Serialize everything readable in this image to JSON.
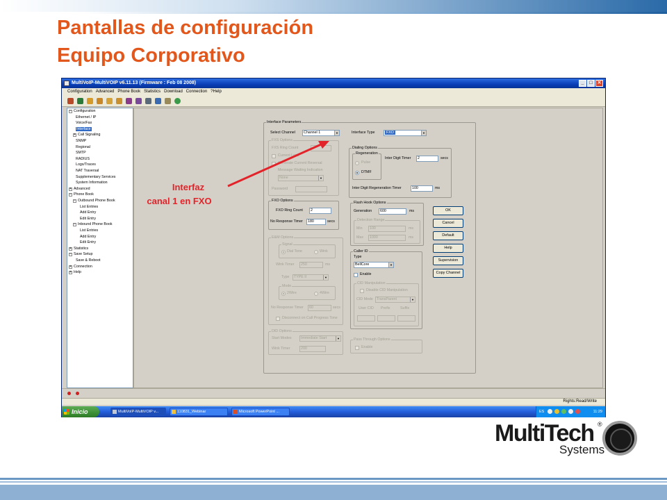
{
  "slide": {
    "title_line1": "Pantallas de configuración",
    "title_line2": "Equipo Corporativo",
    "annotation_line1": "Interfaz",
    "annotation_line2": "canal 1 en FXO"
  },
  "logo": {
    "wordmark": "MultiTech",
    "subtitle": "Systems",
    "registered": "®"
  },
  "window": {
    "title": "MultiVoIP-MultiVOIP v6.11.13 (Firmware : Feb 08 2008)",
    "minimize": "_",
    "maximize": "□",
    "close": "✕"
  },
  "menu": [
    "Configuration",
    "Advanced",
    "Phone Book",
    "Statistics",
    "Download",
    "Connection",
    "?Help"
  ],
  "toolbar_icons": [
    "network-icon",
    "monitor-icon",
    "phone-icon",
    "phone-icon",
    "phone-icon",
    "phone-icon",
    "tools-icon",
    "tools-icon",
    "sync-icon",
    "chart-icon",
    "home-icon",
    "globe-icon"
  ],
  "tree": {
    "items": [
      {
        "label": "Configuration",
        "exp": "−"
      },
      {
        "label": "Ethernet / IP"
      },
      {
        "label": "Voice/Fax"
      },
      {
        "label": "Interface",
        "selected": true
      },
      {
        "label": "Call Signaling",
        "exp": "+"
      },
      {
        "label": "SNMP"
      },
      {
        "label": "Regional"
      },
      {
        "label": "SMTP"
      },
      {
        "label": "RADIUS"
      },
      {
        "label": "Logs/Traces"
      },
      {
        "label": "NAT Traversal"
      },
      {
        "label": "Supplementary Services"
      },
      {
        "label": "System Information"
      },
      {
        "label": "Advanced",
        "exp": "+"
      },
      {
        "label": "Phone Book",
        "exp": "−"
      },
      {
        "label": "Outbound Phone Book",
        "exp": "−"
      },
      {
        "label": "List Entries"
      },
      {
        "label": "Add Entry"
      },
      {
        "label": "Edit Entry"
      },
      {
        "label": "Inbound Phone Book",
        "exp": "−"
      },
      {
        "label": "List Entries"
      },
      {
        "label": "Add Entry"
      },
      {
        "label": "Edit Entry"
      },
      {
        "label": "Statistics",
        "exp": "+"
      },
      {
        "label": "Save Setup",
        "exp": "−"
      },
      {
        "label": "Save & Reboot"
      },
      {
        "label": "Connection",
        "exp": "+"
      },
      {
        "label": "Help",
        "exp": "+"
      }
    ]
  },
  "form": {
    "interface_parameters": "Interface Parameters",
    "select_channel_label": "Select Channel",
    "select_channel_value": "Channel 1",
    "interface_type_label": "Interface Type",
    "interface_type_value": "FXO",
    "fxs_options": {
      "title": "FXS Options",
      "ring_count": "FXS Ring Count",
      "current_loss": "Current Loss",
      "generate_reversal": "Generate Current Reversal",
      "message_waiting": "Message Waiting Indication",
      "none_value": "None",
      "password": "Password"
    },
    "dialing_options": {
      "title": "Dialing Options",
      "regeneration": "Regeneration",
      "pulse": "Pulse",
      "dtmf": "DTMF",
      "inter_digit_timer_label": "Inter Digit Timer",
      "inter_digit_timer_value": "2",
      "secs": "secs",
      "regen_timer_label": "Inter Digit Regeneration Timer",
      "regen_timer_value": "100",
      "ms": "ms"
    },
    "fxo_options": {
      "title": "FXO Options",
      "ring_count_label": "FXO Ring Count",
      "ring_count_value": "2",
      "no_response_label": "No Response Timer",
      "no_response_value": "180",
      "secs": "secs"
    },
    "flash_hook": {
      "title": "Flash Hook Options",
      "generation_label": "Generation",
      "generation_value": "600",
      "ms": "ms",
      "detection_range": "Detection Range",
      "min_label": "Min",
      "min_value": "100",
      "max_label": "Max",
      "max_value": "1000"
    },
    "em_options": {
      "title": "E&M Options",
      "signal": "Signal",
      "dial_tone": "Dial Tone",
      "wink": "Wink",
      "wink_timer_label": "Wink Timer",
      "wink_timer_value": "250",
      "ms": "ms",
      "type_label": "Type",
      "type_value": "TYPE II",
      "mode": "Mode",
      "two_wire": "2Wire",
      "four_wire": "4Wire",
      "no_response_label": "No Response Timer",
      "no_response_value": "60",
      "secs": "secs",
      "disconnect": "Disconnect on Call Progress Tone"
    },
    "did_options": {
      "title": "DID Options",
      "start_modes_label": "Start Modes",
      "start_modes_value": "Immediate Start",
      "wink_timer_label": "Wink Timer",
      "wink_timer_value": "200"
    },
    "caller_id": {
      "title": "Caller ID",
      "type_label": "Type",
      "type_value": "BellCore",
      "enable": "Enable",
      "manipulation": "CID Manipulation",
      "disable_manip": "Disable CID Manipulation",
      "cid_mode_label": "CID Mode",
      "cid_mode_value": "TransParent",
      "user_cid": "User CID",
      "prefix": "Prefix",
      "suffix": "Suffix"
    },
    "pass_through": {
      "title": "Pass Through Options",
      "enable": "Enable"
    },
    "buttons": {
      "ok": "OK",
      "cancel": "Cancel",
      "default": "Default",
      "help": "Help",
      "supervision": "Supervision",
      "copy_channel": "Copy Channel"
    }
  },
  "status": {
    "rights": "Rights:Read/Write"
  },
  "taskbar": {
    "start": "Inicio",
    "tasks": [
      "MultiVoIP-MultiVOIP v...",
      "110831_Webinar",
      "Microsoft PowerPoint ..."
    ],
    "lang": "ES",
    "time": "11:29"
  },
  "colors": {
    "title_orange": "#e2571b",
    "annotation_red": "#e2242a",
    "xp_blue": "#0a3fb8"
  }
}
